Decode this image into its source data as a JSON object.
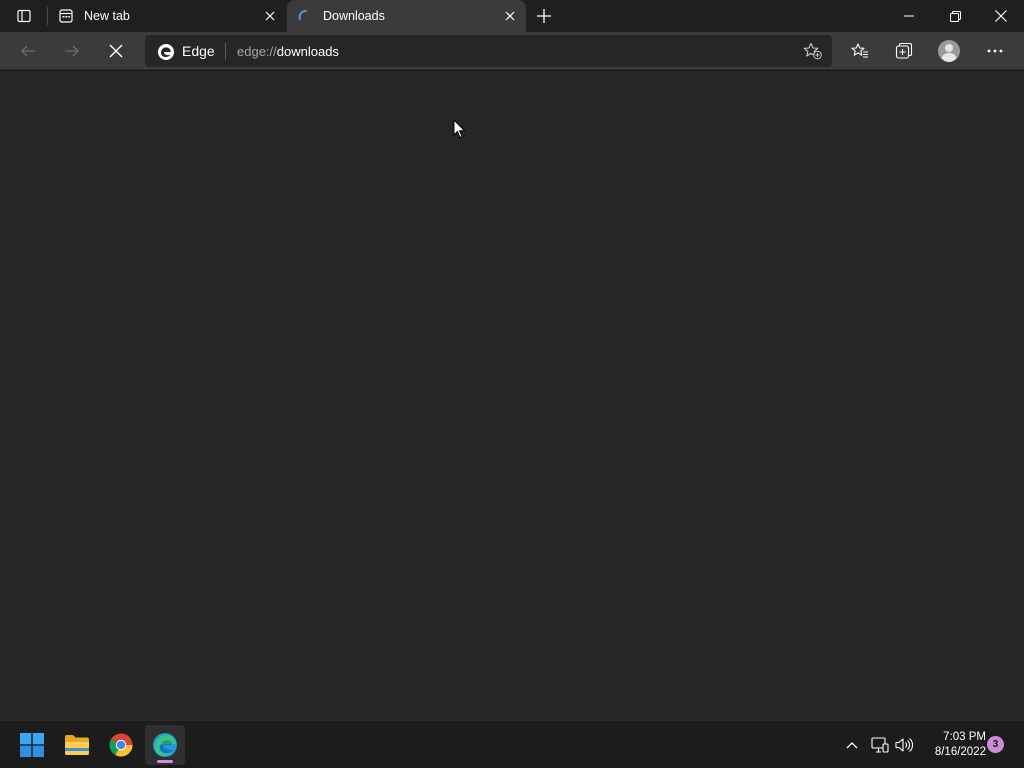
{
  "browser": {
    "tabs": [
      {
        "title": "New tab",
        "active": false,
        "icon": "new-tab-page-icon"
      },
      {
        "title": "Downloads",
        "active": true,
        "loading": true,
        "icon": "loading-spinner-icon"
      }
    ],
    "toolbar": {
      "address_brand": "Edge",
      "address_scheme": "edge://",
      "address_path": "downloads"
    }
  },
  "taskbar": {
    "apps": [
      {
        "name": "Start",
        "icon": "windows-start-icon"
      },
      {
        "name": "File Explorer",
        "icon": "file-explorer-icon"
      },
      {
        "name": "Google Chrome",
        "icon": "chrome-icon"
      },
      {
        "name": "Microsoft Edge",
        "icon": "edge-icon",
        "active": true
      }
    ],
    "clock": {
      "time": "7:03 PM",
      "date": "8/16/2022"
    },
    "notification_count": "3"
  },
  "colors": {
    "tab_strip": "#1f1f1f",
    "toolbar": "#3b3b3b",
    "content": "#262626",
    "taskbar": "#1c1c1c",
    "accent": "#d48fd8"
  }
}
